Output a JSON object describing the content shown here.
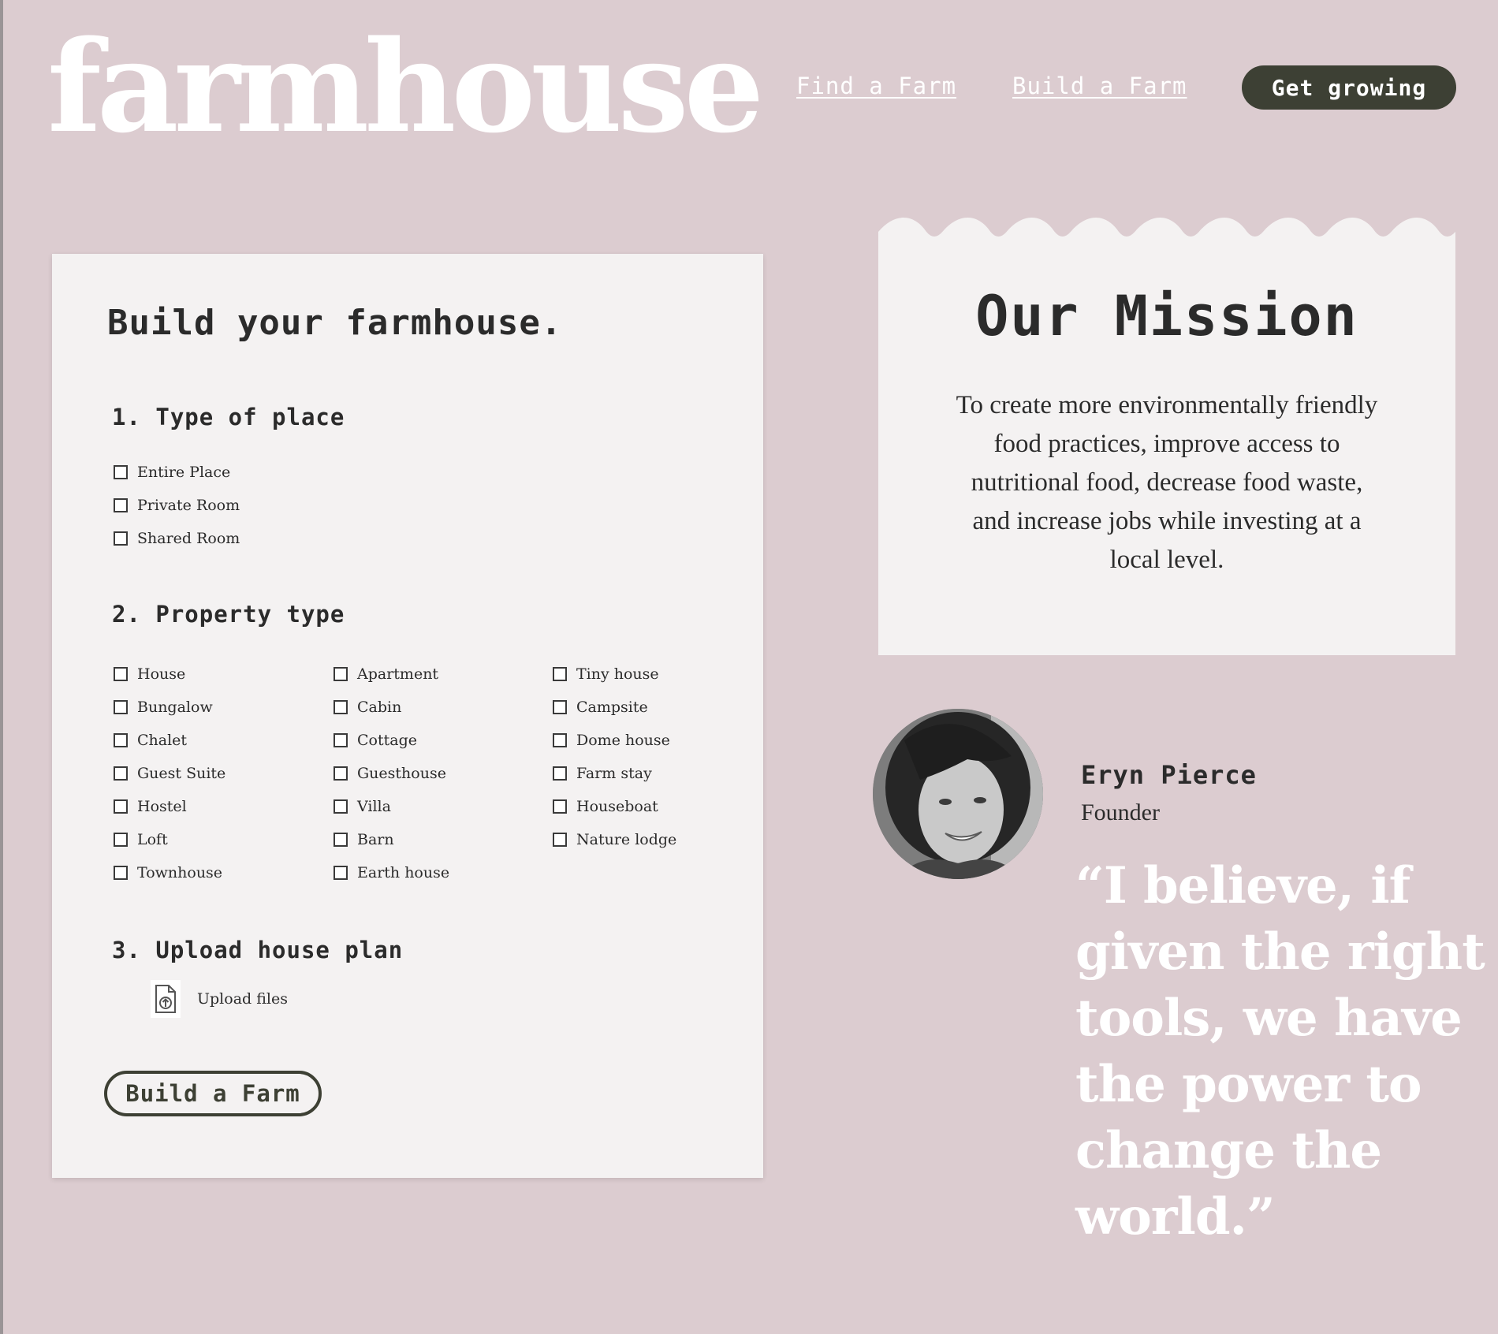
{
  "header": {
    "logo": "farmhouse",
    "nav": [
      {
        "label": "Find a Farm"
      },
      {
        "label": "Build a Farm"
      }
    ],
    "cta_label": "Get growing"
  },
  "form": {
    "title": "Build your farmhouse.",
    "section1": {
      "heading": "1. Type of place",
      "options": [
        "Entire Place",
        "Private Room",
        "Shared Room"
      ]
    },
    "section2": {
      "heading": "2. Property type",
      "columns": [
        [
          "House",
          "Bungalow",
          "Chalet",
          "Guest Suite",
          "Hostel",
          "Loft",
          "Townhouse"
        ],
        [
          "Apartment",
          "Cabin",
          "Cottage",
          "Guesthouse",
          "Villa",
          "Barn",
          "Earth house"
        ],
        [
          "Tiny house",
          "Campsite",
          "Dome house",
          "Farm stay",
          "Houseboat",
          "Nature lodge"
        ]
      ]
    },
    "section3": {
      "heading": "3. Upload house plan",
      "upload_label": "Upload files",
      "upload_icon": "file-upload-icon"
    },
    "submit_label": "Build a Farm"
  },
  "mission": {
    "title": "Our Mission",
    "text": "To create more environmentally friendly food practices, improve access to nutritional food, decrease food waste, and increase jobs while investing at a local level."
  },
  "founder": {
    "name": "Eryn Pierce",
    "role": "Founder",
    "quote": "“I believe, if given the right tools, we have the power to change the world.”"
  },
  "colors": {
    "background": "#dcccd0",
    "card": "#f4f2f2",
    "accent_dark": "#3d4034",
    "text": "#2b2b2b",
    "white": "#ffffff"
  }
}
